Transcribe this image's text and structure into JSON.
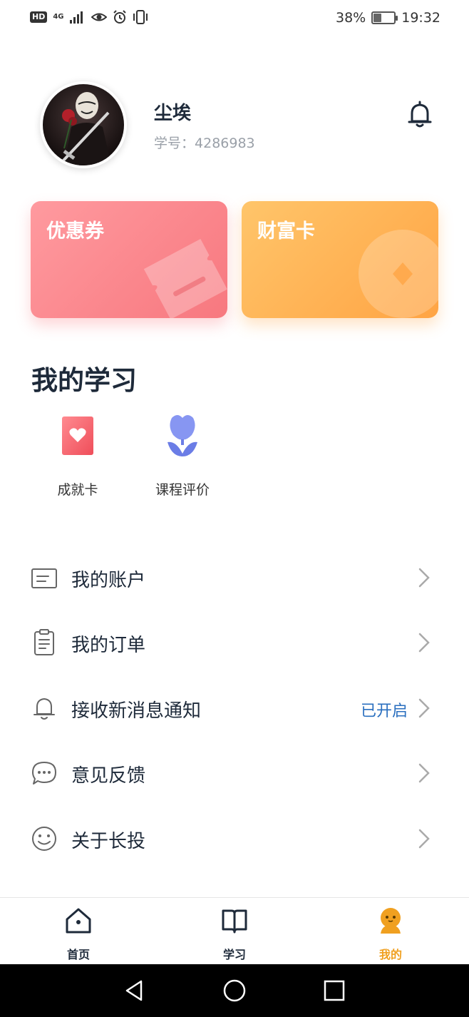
{
  "status_bar": {
    "hd": "HD",
    "network": "4G",
    "battery": "38%",
    "battery_level": 0.38,
    "time": "19:32"
  },
  "profile": {
    "name": "尘埃",
    "id_label": "学号：",
    "id_value": "4286983"
  },
  "cards": {
    "coupon": "优惠券",
    "wealth": "财富卡"
  },
  "study": {
    "title": "我的学习",
    "items": [
      {
        "label": "成就卡",
        "icon": "heart-card-icon"
      },
      {
        "label": "课程评价",
        "icon": "tulip-icon"
      }
    ]
  },
  "menu": [
    {
      "label": "我的账户",
      "icon": "account-icon",
      "status": ""
    },
    {
      "label": "我的订单",
      "icon": "order-icon",
      "status": ""
    },
    {
      "label": "接收新消息通知",
      "icon": "bell-icon",
      "status": "已开启"
    },
    {
      "label": "意见反馈",
      "icon": "chat-icon",
      "status": ""
    },
    {
      "label": "关于长投",
      "icon": "smile-icon",
      "status": ""
    }
  ],
  "tabs": [
    {
      "label": "首页",
      "icon": "home-icon",
      "active": false
    },
    {
      "label": "学习",
      "icon": "book-icon",
      "active": false
    },
    {
      "label": "我的",
      "icon": "profile-icon",
      "active": true
    }
  ],
  "colors": {
    "accent": "#f0a020",
    "link": "#2a6fbf",
    "coupon": "#f7787f",
    "wealth": "#ffa444",
    "text_dark": "#1e2a3a"
  }
}
